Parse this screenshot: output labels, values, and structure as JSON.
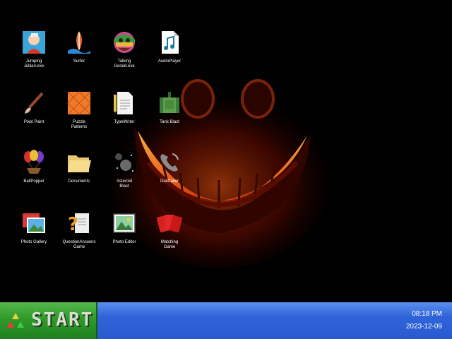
{
  "desktop": {
    "icons": [
      {
        "label": "Jumping\nJullian.exe",
        "icon": "jumping-julian-icon"
      },
      {
        "label": "Surfer",
        "icon": "surfer-icon"
      },
      {
        "label": "Talking\nGerald.exe",
        "icon": "talking-gerald-icon"
      },
      {
        "label": "AudioPlayer",
        "icon": "audio-player-icon"
      },
      {
        "label": "Pixel Paint",
        "icon": "paintbrush-icon"
      },
      {
        "label": "Puzzle\nPatterns",
        "icon": "puzzle-patterns-icon"
      },
      {
        "label": "TypeWriter",
        "icon": "typewriter-icon"
      },
      {
        "label": "Tank Blast",
        "icon": "tank-icon"
      },
      {
        "label": "BallPopper",
        "icon": "balloons-icon"
      },
      {
        "label": "Documents",
        "icon": "folder-icon"
      },
      {
        "label": "Asteroid\nBlast",
        "icon": "asteroid-icon"
      },
      {
        "label": "DialCaller",
        "icon": "phone-icon"
      },
      {
        "label": "Photo Gallery",
        "icon": "photo-gallery-icon"
      },
      {
        "label": "QuestionAnswers\nGame",
        "icon": "question-game-icon"
      },
      {
        "label": "Photo Editor",
        "icon": "photo-editor-icon"
      },
      {
        "label": "Matching\nGame",
        "icon": "cards-icon"
      }
    ]
  },
  "taskbar": {
    "start_label": "START",
    "time": "08:18 PM",
    "date": "2023-12-09"
  },
  "colors": {
    "taskbar_blue": "#2f63d8",
    "start_green": "#2f9a2a",
    "wallpaper_glow": "#ff3b00"
  }
}
